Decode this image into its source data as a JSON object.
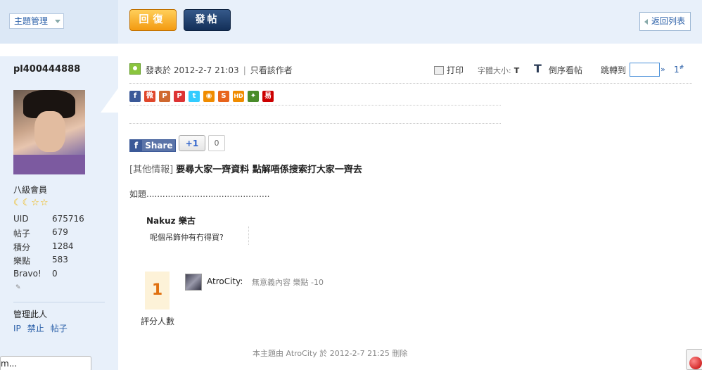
{
  "toolbar": {
    "topic_manage": "主題管理",
    "reply": "回復",
    "post": "發帖",
    "back_to_list": "返回列表"
  },
  "user": {
    "name": "pl400444888",
    "rank": "八級會員",
    "stars": "☾☾☆☆",
    "stats": [
      {
        "key": "UID",
        "value": "675716"
      },
      {
        "key": "帖子",
        "value": "679"
      },
      {
        "key": "積分",
        "value": "1284"
      },
      {
        "key": "樂點",
        "value": "583"
      },
      {
        "key": "Bravo!",
        "value": "0"
      }
    ],
    "manage_label": "管理此人",
    "manage_links": [
      "IP",
      "禁止",
      "帖子"
    ]
  },
  "post_header": {
    "posted_at": "發表於 2012-2-7 21:03",
    "only_author": "只看該作者",
    "print": "打印",
    "font_size": "字體大小:",
    "font_size_t": "T",
    "big_t": "T",
    "reverse": "倒序看帖",
    "jump_to": "跳轉到",
    "jump_go": "»",
    "floor": "1",
    "floor_sup": "#"
  },
  "share": {
    "icons": [
      {
        "name": "facebook-icon",
        "glyph": "f",
        "color": "#3b5998"
      },
      {
        "name": "weibo-icon",
        "glyph": "微",
        "color": "#e0472b"
      },
      {
        "name": "plurk-icon",
        "glyph": "P",
        "color": "#cf682f"
      },
      {
        "name": "p-icon",
        "glyph": "P",
        "color": "#d33"
      },
      {
        "name": "twitter-icon",
        "glyph": "t",
        "color": "#33ccff"
      },
      {
        "name": "orange-square-icon",
        "glyph": "◉",
        "color": "#f08c00"
      },
      {
        "name": "sohu-icon",
        "glyph": "S",
        "color": "#e8641c"
      },
      {
        "name": "hd-icon",
        "glyph": "HD",
        "color": "#f08c00"
      },
      {
        "name": "google-icon",
        "glyph": "✦",
        "color": "#4a8c2a"
      },
      {
        "name": "yi-icon",
        "glyph": "易",
        "color": "#c00"
      }
    ],
    "fb_share": "Share",
    "fb_f": "f",
    "gplus": "+1",
    "gplus_count": "0"
  },
  "post": {
    "category": "[其他情報]",
    "title": "要尋大家一齊資料 點解唔係搜索打大家一齊去",
    "body": "如題..............................................",
    "quote_author": "Nakuz 樂古",
    "quote_text": "呢個吊飾仲有冇得買?"
  },
  "rating": {
    "count": "1",
    "label": "評分人數",
    "rater_name": "AtroCity:",
    "rater_detail": "無意義內容 樂點 -10"
  },
  "footer": {
    "note": "本主題由 AtroCity 於 2012-2-7 21:25 刪除",
    "bottom_tab": "m..."
  }
}
